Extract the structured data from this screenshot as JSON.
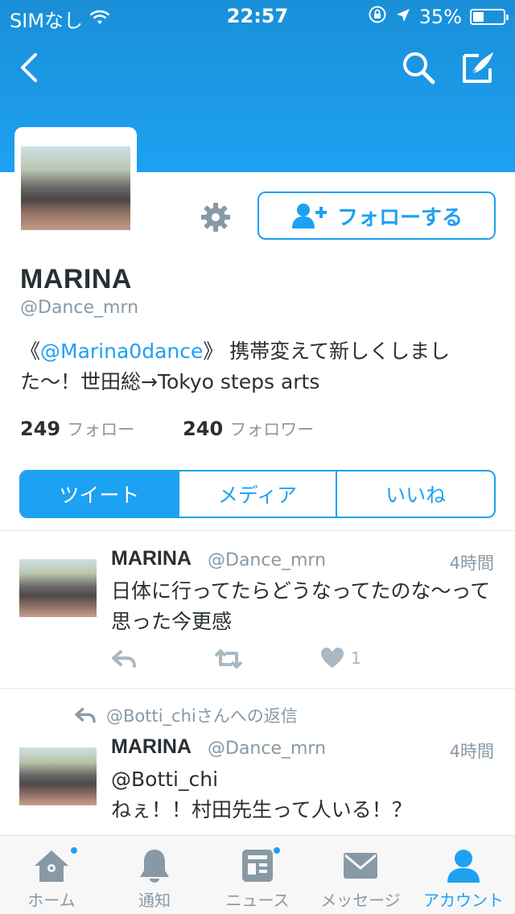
{
  "status_bar": {
    "carrier": "SIMなし",
    "time": "22:57",
    "battery": "35%",
    "battery_level": 0.35
  },
  "profile": {
    "name": "MARINA",
    "handle": "@Dance_mrn",
    "bio_prefix": "《",
    "bio_mention": "@Marina0dance",
    "bio_rest": "》 携帯変えて新しくしました〜！世田総→Tokyo steps arts",
    "following_count": "249",
    "following_label": "フォロー",
    "followers_count": "240",
    "followers_label": "フォロワー",
    "follow_button": "フォローする"
  },
  "tabs": [
    {
      "label": "ツイート",
      "active": true
    },
    {
      "label": "メディア",
      "active": false
    },
    {
      "label": "いいね",
      "active": false
    }
  ],
  "tweets": [
    {
      "name": "MARINA",
      "handle": "@Dance_mrn",
      "time": "4時間",
      "text": "日体に行ってたらどうなってたのな〜って思った今更感",
      "like_count": "1"
    },
    {
      "reply_context": "@Botti_chiさんへの返信",
      "name": "MARINA",
      "handle": "@Dance_mrn",
      "time": "4時間",
      "text_line1": "@Botti_chi",
      "text_line2": "ねぇ！！村田先生って人いる！？"
    }
  ],
  "tabbar": [
    {
      "label": "ホーム",
      "icon": "home-icon",
      "badge": true,
      "active": false
    },
    {
      "label": "通知",
      "icon": "bell-icon",
      "badge": false,
      "active": false
    },
    {
      "label": "ニュース",
      "icon": "news-icon",
      "badge": true,
      "active": false
    },
    {
      "label": "メッセージ",
      "icon": "envelope-icon",
      "badge": false,
      "active": false
    },
    {
      "label": "アカウント",
      "icon": "person-icon",
      "badge": false,
      "active": true
    }
  ],
  "colors": {
    "accent": "#1da1f2",
    "text": "#292f33",
    "muted": "#8899a6"
  }
}
